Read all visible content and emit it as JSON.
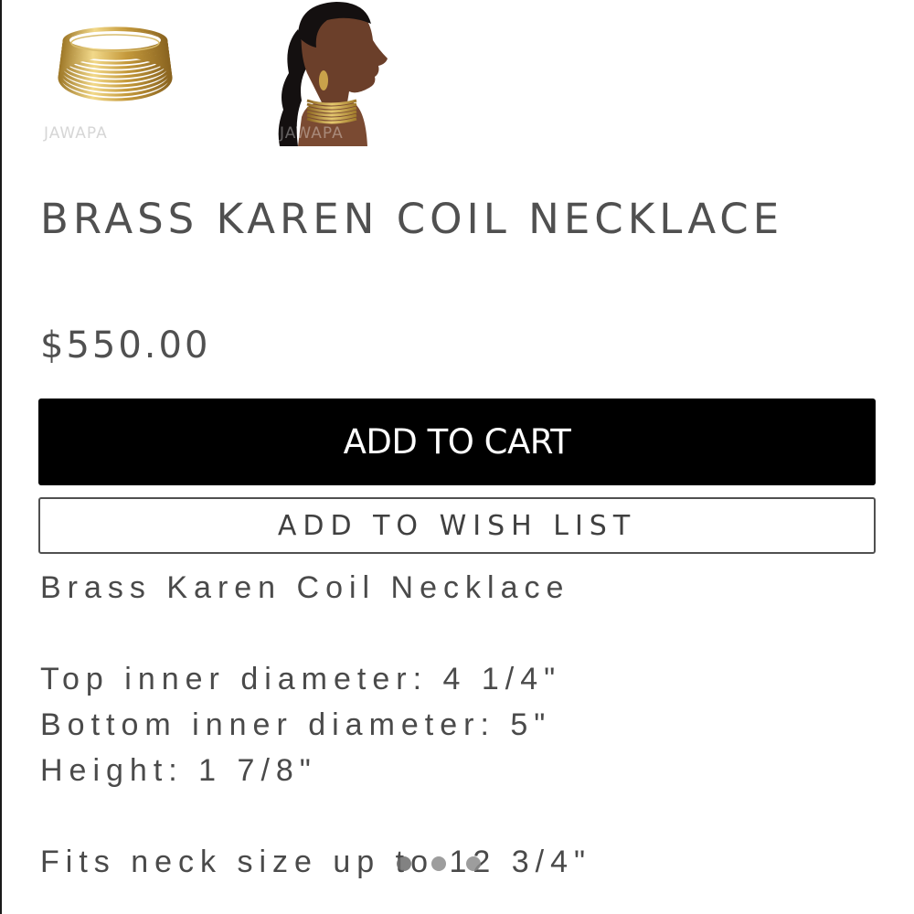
{
  "gallery": {
    "thumbnails": [
      {
        "icon": "coil-necklace-product-photo",
        "watermark": "JAWAPA"
      },
      {
        "icon": "model-wearing-necklace-photo",
        "watermark": "JAWAPA"
      }
    ]
  },
  "product": {
    "title": "BRASS KAREN COIL NECKLACE",
    "price": "$550.00"
  },
  "actions": {
    "add_to_cart_label": "ADD TO CART",
    "add_to_wish_list_label": "ADD TO WISH LIST"
  },
  "description": {
    "heading": "Brass Karen Coil Necklace",
    "top_inner_diameter": "Top inner diameter: 4 1/4\"",
    "bottom_inner_diameter": "Bottom inner diameter: 5\"",
    "height": "Height: 1 7/8\"",
    "fits": "Fits neck size up to 12 3/4\""
  },
  "carousel": {
    "page_count": 3,
    "active_index": 0
  },
  "colors": {
    "button_primary": "#000000",
    "text": "#4a4a4a",
    "gold": "#c9a24a"
  }
}
